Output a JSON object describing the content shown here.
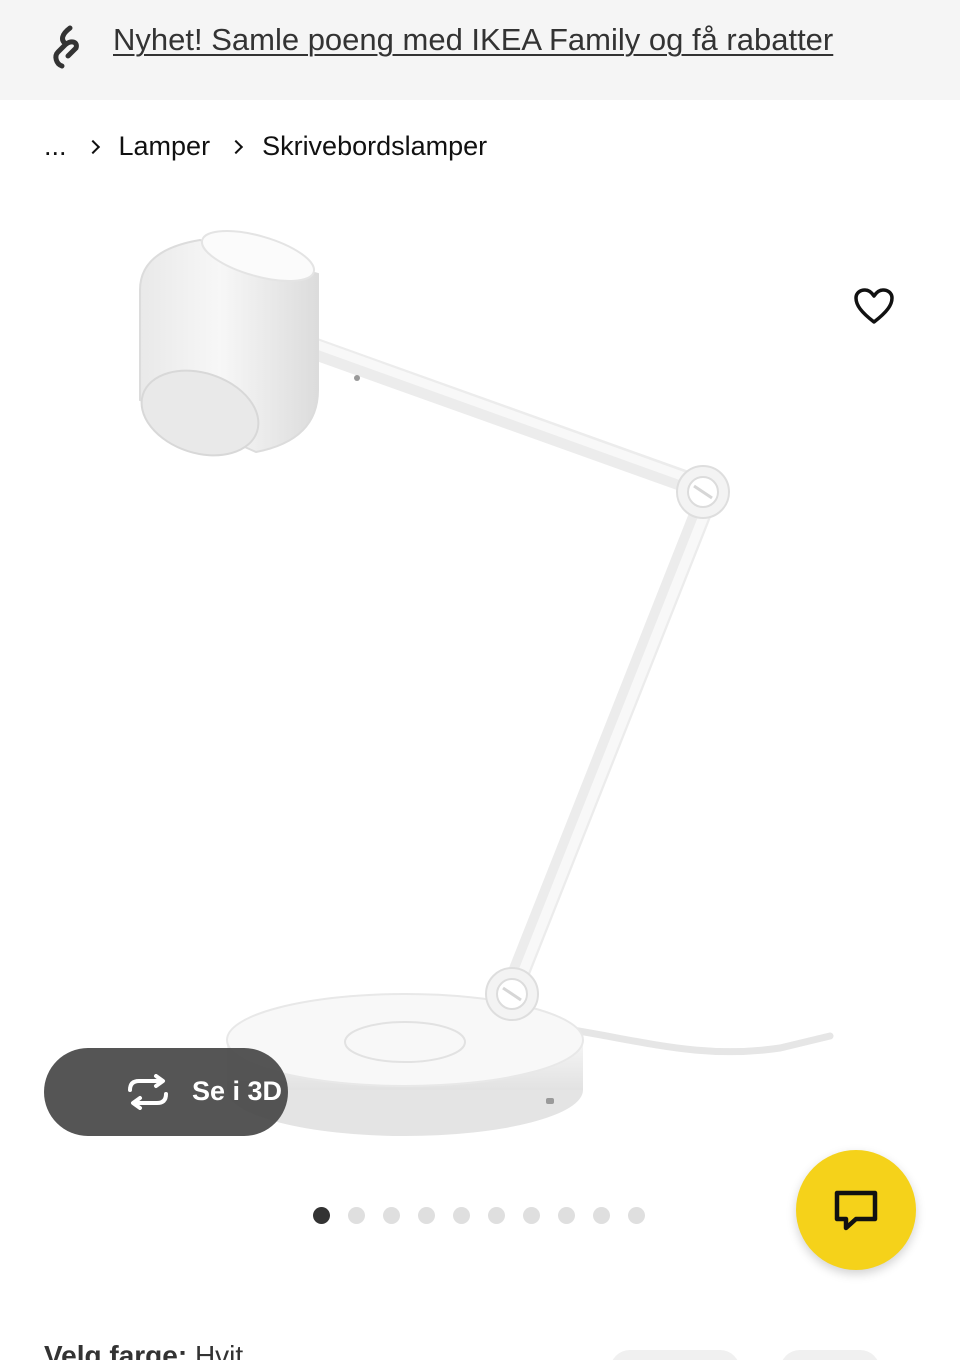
{
  "promo": {
    "text": "Nyhet! Samle poeng med IKEA Family og få rabatter",
    "icon": "ikea-family-icon"
  },
  "breadcrumb": {
    "items": [
      "...",
      "Lamper",
      "Skrivebordslamper"
    ]
  },
  "gallery": {
    "favorite_icon": "heart-icon",
    "view3d_label": "Se i 3D",
    "view3d_icon": "rotate-3d-icon",
    "dots_total": 10,
    "active_dot": 1
  },
  "chat": {
    "icon": "chat-bubble-icon",
    "color": "#f5d21a"
  },
  "product_options": {
    "color_key": "Velg farge:",
    "color_value": "Hvit"
  }
}
